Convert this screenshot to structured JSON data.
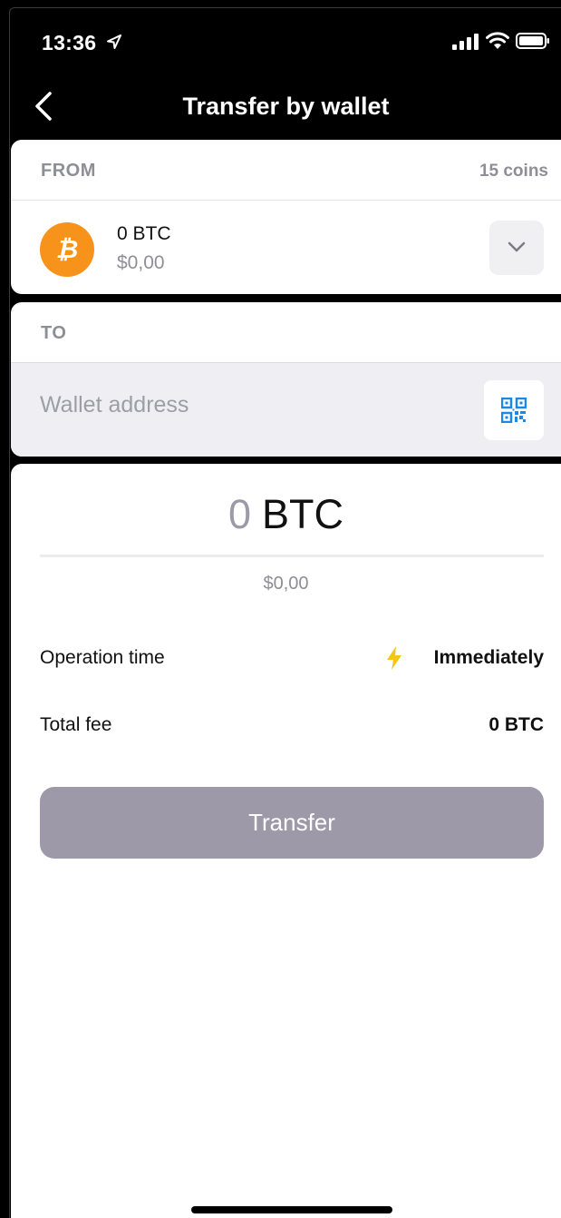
{
  "status_bar": {
    "time": "13:36"
  },
  "nav": {
    "title": "Transfer by wallet"
  },
  "from": {
    "label": "FROM",
    "count": "15 coins",
    "coin_symbol": "₿",
    "coin_amount": "0 BTC",
    "coin_fiat": "$0,00"
  },
  "to": {
    "label": "TO",
    "address_placeholder": "Wallet address"
  },
  "amount": {
    "value": "0",
    "unit": "BTC",
    "fiat": "$0,00"
  },
  "operation": {
    "label": "Operation time",
    "value": "Immediately"
  },
  "fee": {
    "label": "Total fee",
    "value": "0 BTC"
  },
  "actions": {
    "transfer_label": "Transfer"
  },
  "colors": {
    "bitcoin": "#f7931a",
    "accent_blue": "#1e88e5",
    "disabled_button": "#9e99a8",
    "bolt": "#f5c518"
  }
}
